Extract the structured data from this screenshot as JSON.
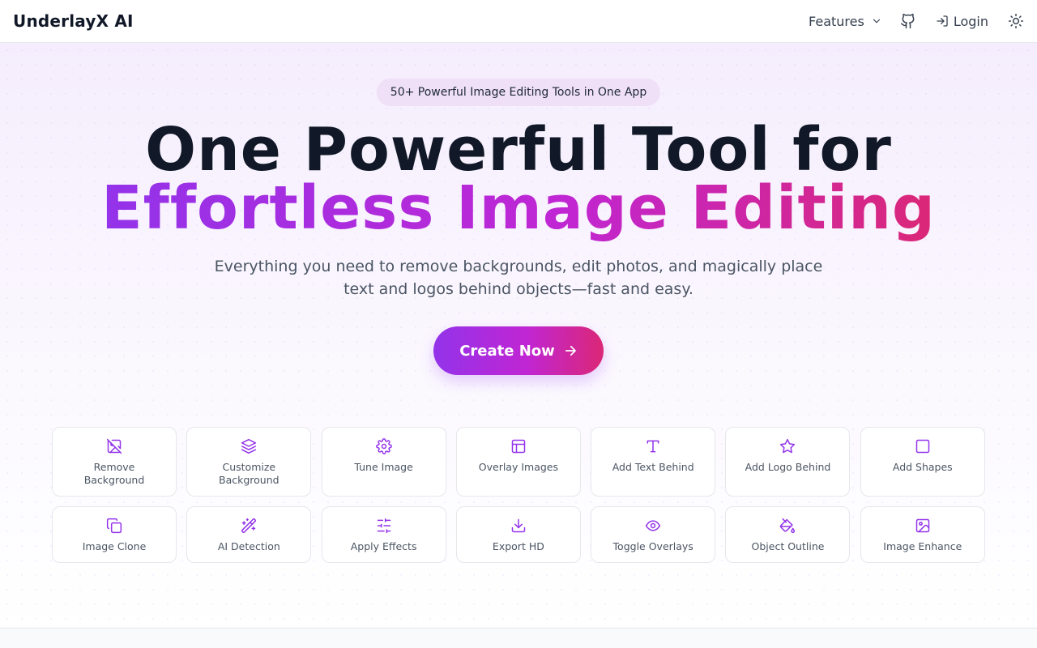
{
  "app": {
    "brand": "UnderlayX AI"
  },
  "nav": {
    "features_label": "Features",
    "login_label": "Login",
    "icons": {
      "features_chevron": "chevron-down-icon",
      "github": "github-icon",
      "login": "login-icon",
      "theme": "sun-icon"
    }
  },
  "hero": {
    "pill": "50+ Powerful Image Editing Tools in One App",
    "title_line1": "One Powerful Tool for",
    "title_line2": "Effortless Image Editing",
    "subtitle": "Everything you need to remove backgrounds, edit photos, and magically place text and logos behind objects—fast and easy.",
    "cta_label": "Create Now"
  },
  "features": [
    {
      "label": "Remove Background",
      "icon": "image-off-icon"
    },
    {
      "label": "Customize Background",
      "icon": "layers-icon"
    },
    {
      "label": "Tune Image",
      "icon": "gear-icon"
    },
    {
      "label": "Overlay Images",
      "icon": "layout-icon"
    },
    {
      "label": "Add Text Behind",
      "icon": "type-icon"
    },
    {
      "label": "Add Logo Behind",
      "icon": "star-icon"
    },
    {
      "label": "Add Shapes",
      "icon": "square-icon"
    },
    {
      "label": "Image Clone",
      "icon": "copy-icon"
    },
    {
      "label": "AI Detection",
      "icon": "magic-wand-icon"
    },
    {
      "label": "Apply Effects",
      "icon": "sliders-icon"
    },
    {
      "label": "Export HD",
      "icon": "download-icon"
    },
    {
      "label": "Toggle Overlays",
      "icon": "eye-icon"
    },
    {
      "label": "Object Outline",
      "icon": "paint-bucket-icon"
    },
    {
      "label": "Image Enhance",
      "icon": "image-icon"
    }
  ],
  "colors": {
    "accent_purple": "#9333ea",
    "accent_pink": "#db2777",
    "icon_purple": "#9333ea",
    "pill_bg": "#efe0f7"
  }
}
